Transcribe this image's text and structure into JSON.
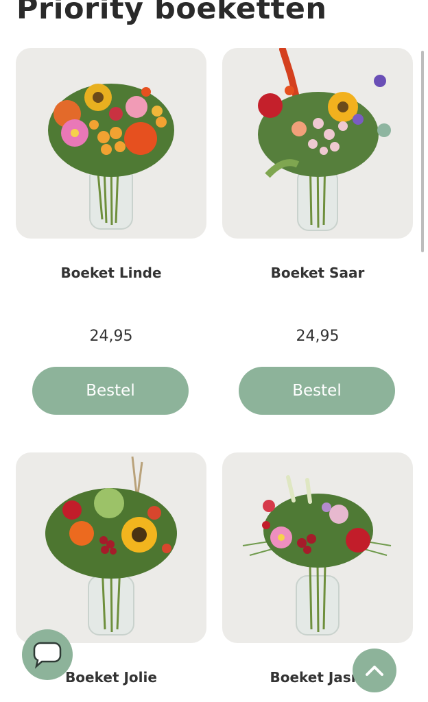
{
  "page": {
    "title": "Priority boeketten"
  },
  "products": [
    {
      "name": "Boeket Linde",
      "price": "24,95",
      "button_label": "Bestel"
    },
    {
      "name": "Boeket Saar",
      "price": "24,95",
      "button_label": "Bestel"
    },
    {
      "name": "Boeket Jolie"
    },
    {
      "name": "Boeket Jasm"
    }
  ],
  "colors": {
    "accent": "#8db39a",
    "card_background": "#ecebe8",
    "text": "#2a2a2a"
  },
  "icons": {
    "chat": "chat-bubble-icon",
    "back_to_top": "chevron-up-icon"
  }
}
